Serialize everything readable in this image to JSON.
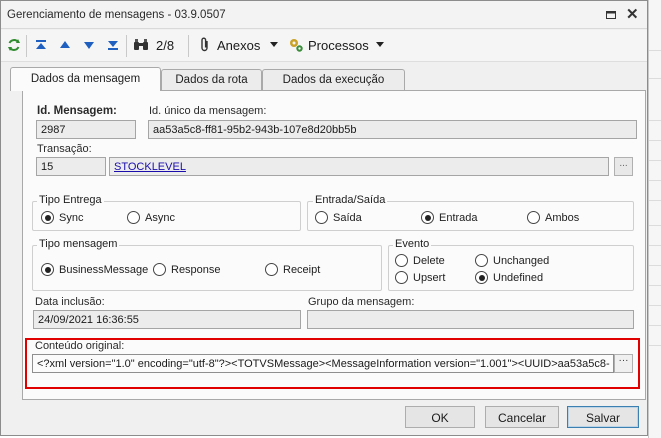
{
  "window": {
    "title": "Gerenciamento de mensagens - 03.9.0507"
  },
  "toolbar": {
    "position": "2/8",
    "attachments_label": "Anexos",
    "processes_label": "Processos"
  },
  "tabs": [
    {
      "label": "Dados da mensagem",
      "active": true
    },
    {
      "label": "Dados da rota",
      "active": false
    },
    {
      "label": "Dados da execução",
      "active": false
    }
  ],
  "message": {
    "id_label": "Id. Mensagem:",
    "id_value": "2987",
    "unique_id_label": "Id. único da mensagem:",
    "unique_id_value": "aa53a5c8-ff81-95b2-943b-107e8d20bb5b",
    "transaction_label": "Transação:",
    "transaction_code": "15",
    "transaction_name": "STOCKLEVEL",
    "transaction_button": "..."
  },
  "tipo_entrega": {
    "title": "Tipo Entrega",
    "options": [
      {
        "label": "Sync",
        "selected": true
      },
      {
        "label": "Async",
        "selected": false
      }
    ]
  },
  "entrada_saida": {
    "title": "Entrada/Saída",
    "options": [
      {
        "label": "Saída",
        "selected": false
      },
      {
        "label": "Entrada",
        "selected": true
      },
      {
        "label": "Ambos",
        "selected": false
      }
    ]
  },
  "tipo_mensagem": {
    "title": "Tipo mensagem",
    "options": [
      {
        "label": "BusinessMessage",
        "selected": true
      },
      {
        "label": "Response",
        "selected": false
      },
      {
        "label": "Receipt",
        "selected": false
      }
    ]
  },
  "evento": {
    "title": "Evento",
    "options": [
      {
        "label": "Delete",
        "selected": false
      },
      {
        "label": "Unchanged",
        "selected": false
      },
      {
        "label": "Upsert",
        "selected": false
      },
      {
        "label": "Undefined",
        "selected": true
      }
    ]
  },
  "data_inclusao": {
    "label": "Data inclusão:",
    "value": "24/09/2021 16:36:55"
  },
  "grupo_mensagem": {
    "label": "Grupo da mensagem:",
    "value": ""
  },
  "conteudo": {
    "label": "Conteúdo original:",
    "value": "<?xml version=\"1.0\" encoding=\"utf-8\"?><TOTVSMessage><MessageInformation version=\"1.001\"><UUID>aa53a5c8-",
    "button": "···"
  },
  "buttons": {
    "ok": "OK",
    "cancel": "Cancelar",
    "save": "Salvar"
  },
  "colors": {
    "highlight": "#e00000",
    "link": "#1a0dab"
  }
}
